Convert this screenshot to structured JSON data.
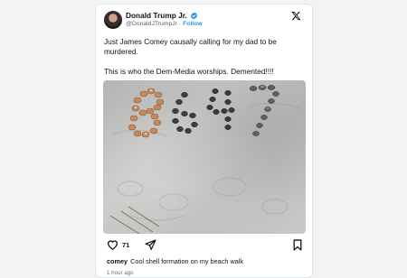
{
  "author": {
    "name": "Donald Trump Jr.",
    "handle": "@DonaldJTrumpJr",
    "separator": "·",
    "follow_label": "Follow",
    "verified_color": "#1d9bf0"
  },
  "tweet": {
    "text_line1": "Just James Comey causally calling for my dad to be murdered.",
    "text_line2": "This is who the Dem-Media worships. Demented!!!!"
  },
  "embedded_post": {
    "likes": "71",
    "caption_user": "comey",
    "caption_text": "Cool shell formation on my beach walk",
    "time": "1 hour ago"
  },
  "icons": [
    "x-logo-icon",
    "verified-badge-icon",
    "heart-icon",
    "share-icon",
    "bookmark-icon"
  ],
  "colors": {
    "accent": "#1d9bf0",
    "text": "#0f1419",
    "muted": "#536471"
  }
}
